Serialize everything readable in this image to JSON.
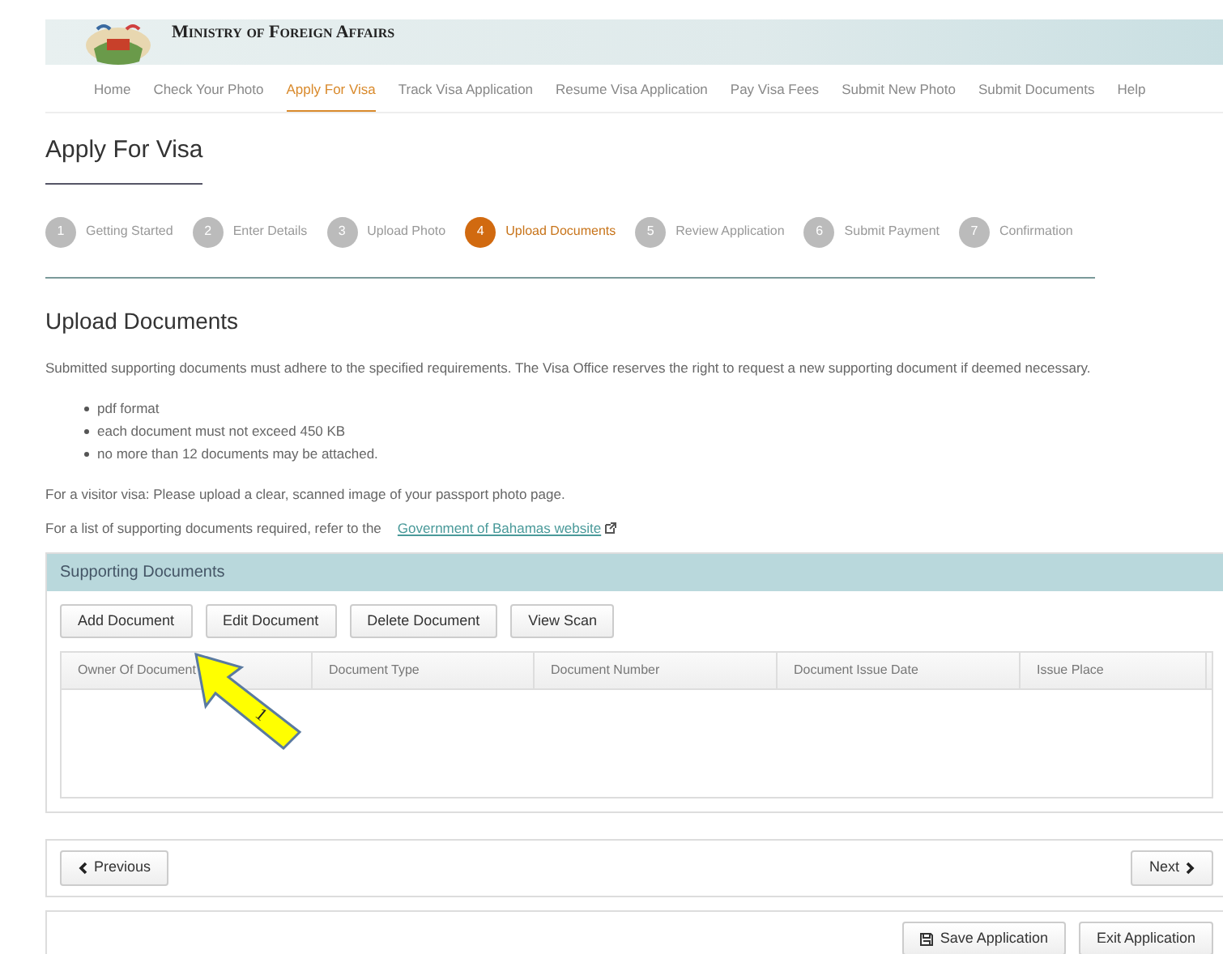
{
  "header": {
    "title": "Ministry of Foreign Affairs"
  },
  "nav": [
    {
      "label": "Home",
      "selected": false
    },
    {
      "label": "Check Your Photo",
      "selected": false
    },
    {
      "label": "Apply For Visa",
      "selected": true
    },
    {
      "label": "Track Visa Application",
      "selected": false
    },
    {
      "label": "Resume Visa Application",
      "selected": false
    },
    {
      "label": "Pay Visa Fees",
      "selected": false
    },
    {
      "label": "Submit New Photo",
      "selected": false
    },
    {
      "label": "Submit Documents",
      "selected": false
    },
    {
      "label": "Help",
      "selected": false
    }
  ],
  "page_title": "Apply For Visa",
  "steps": [
    {
      "number": "1",
      "label": "Getting Started",
      "selected": false
    },
    {
      "number": "2",
      "label": "Enter Details",
      "selected": false
    },
    {
      "number": "3",
      "label": "Upload Photo",
      "selected": false
    },
    {
      "number": "4",
      "label": "Upload Documents",
      "selected": true
    },
    {
      "number": "5",
      "label": "Review Application",
      "selected": false
    },
    {
      "number": "6",
      "label": "Submit Payment",
      "selected": false
    },
    {
      "number": "7",
      "label": "Confirmation",
      "selected": false
    }
  ],
  "section_title": "Upload Documents",
  "intro": "Submitted supporting documents must adhere to the specified requirements. The Visa Office reserves the right to request a new supporting document if deemed necessary.",
  "requirements": [
    "pdf format",
    "each document must not exceed 450 KB",
    "no more than 12 documents may be attached."
  ],
  "visitor_note": "For a visitor visa: Please upload a clear, scanned image of your passport photo page.",
  "list_note": {
    "text": "For a list of supporting documents required, refer to the",
    "link": "Government of Bahamas website"
  },
  "panel": {
    "title": "Supporting Documents",
    "buttons": [
      "Add Document",
      "Edit Document",
      "Delete Document",
      "View Scan"
    ],
    "columns": [
      "Owner Of Document",
      "Document Type",
      "Document Number",
      "Document Issue Date",
      "Issue Place"
    ]
  },
  "callout": {
    "number": "1"
  },
  "pager": {
    "previous": "Previous",
    "next": "Next"
  },
  "footer_buttons": [
    "Save Application",
    "Exit Application"
  ]
}
